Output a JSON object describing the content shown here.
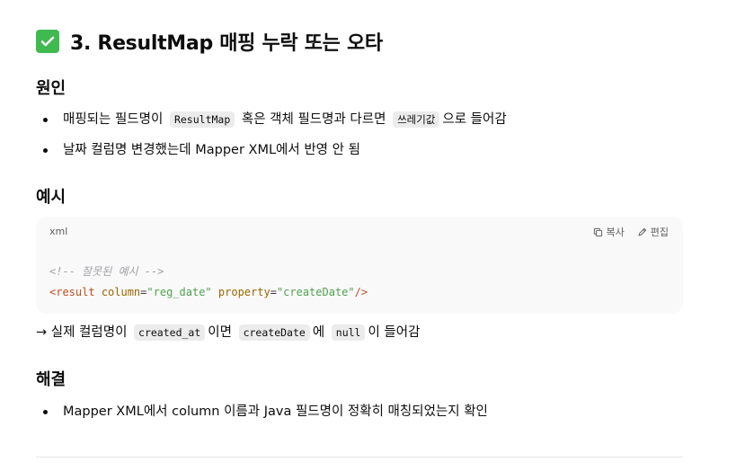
{
  "section_title": "3. ResultMap 매핑 누락 또는 오타",
  "cause": {
    "heading": "원인",
    "bullet1": {
      "before": "매핑되는 필드명이",
      "code": "ResultMap",
      "middle": "혹은 객체 필드명과 다르면",
      "code2": "쓰레기값",
      "after": "으로 들어감"
    },
    "bullet2": "날짜 컬럼명 변경했는데 Mapper XML에서 반영 안 됨"
  },
  "example": {
    "heading": "예시",
    "lang": "xml",
    "copy_label": "복사",
    "edit_label": "편집",
    "code_comment": "<!-- 잘못된 예시 -->",
    "code_tag_open": "<result",
    "attr1": "column",
    "val1": "\"reg_date\"",
    "attr2": "property",
    "val2": "\"createDate\"",
    "code_tag_close": "/>",
    "note": {
      "prefix": "→ 실제 컬럼명이",
      "code1": "created_at",
      "mid1": "이면",
      "code2": "createDate",
      "mid2": "에",
      "code3": "null",
      "suffix": "이 들어감"
    }
  },
  "solution": {
    "heading": "해결",
    "bullet1": "Mapper XML에서 column 이름과 Java 필드명이 정확히 매칭되었는지 확인"
  },
  "icons": {
    "title_icon": "check-mark-button-icon",
    "copy_icon": "copy-icon",
    "edit_icon": "pencil-icon"
  },
  "colors": {
    "check_green": "#3fb950",
    "code_bg": "#f9f9f9"
  }
}
